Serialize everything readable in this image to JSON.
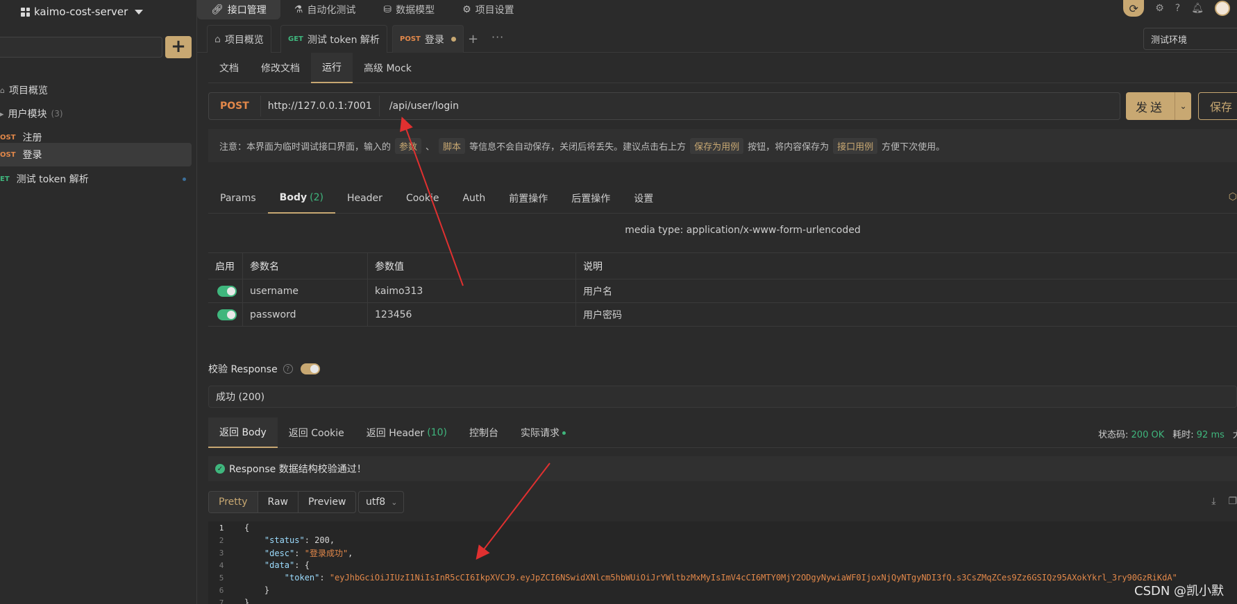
{
  "sidebar": {
    "project_name": "kaimo-cost-server",
    "items": [
      {
        "label": "项目概览",
        "method": ""
      },
      {
        "label": "用户模块",
        "method": "",
        "count": "(3)"
      },
      {
        "label": "注册",
        "method": "OST"
      },
      {
        "label": "登录",
        "method": "OST"
      },
      {
        "label": "测试 token 解析",
        "method": "ET"
      }
    ]
  },
  "topnav": {
    "items": [
      "接口管理",
      "自动化测试",
      "数据模型",
      "项目设置"
    ]
  },
  "tabs": [
    {
      "method": "",
      "label": "项目概览"
    },
    {
      "method": "GET",
      "label": "测试 token 解析"
    },
    {
      "method": "POST",
      "label": "登录"
    }
  ],
  "env": "测试环境",
  "subtabs": [
    "文档",
    "修改文档",
    "运行",
    "高级 Mock"
  ],
  "request": {
    "method": "POST",
    "base_url": "http://127.0.0.1:7001",
    "path": "/api/user/login",
    "send_label": "发送",
    "save_label": "保存"
  },
  "notice": {
    "prefix": "注意：本界面为临时调试接口界面，输入的",
    "hl1": "参数",
    "sep": "、",
    "hl2": "脚本",
    "mid": "等信息不会自动保存，关闭后将丢失。建议点击右上方",
    "hl3": "保存为用例",
    "mid2": "按钮，将内容保存为",
    "hl4": "接口用例",
    "suffix": "方便下次使用。"
  },
  "reqtabs": [
    {
      "label": "Params",
      "badge": ""
    },
    {
      "label": "Body",
      "badge": "(2)"
    },
    {
      "label": "Header",
      "badge": ""
    },
    {
      "label": "Cookie",
      "badge": ""
    },
    {
      "label": "Auth",
      "badge": ""
    },
    {
      "label": "前置操作",
      "badge": ""
    },
    {
      "label": "后置操作",
      "badge": ""
    },
    {
      "label": "设置",
      "badge": ""
    }
  ],
  "media_type": "media type: application/x-www-form-urlencoded",
  "params_table": {
    "headers": [
      "启用",
      "参数名",
      "参数值",
      "说明"
    ],
    "rows": [
      {
        "name": "username",
        "value": "kaimo313",
        "desc": "用户名"
      },
      {
        "name": "password",
        "value": "123456",
        "desc": "用户密码"
      }
    ]
  },
  "validate_label": "校验 Response",
  "response_select": "成功 (200)",
  "resptabs": [
    {
      "label": "返回 Body",
      "badge": ""
    },
    {
      "label": "返回 Cookie",
      "badge": ""
    },
    {
      "label": "返回 Header",
      "badge": "(10)"
    },
    {
      "label": "控制台",
      "badge": ""
    },
    {
      "label": "实际请求",
      "badge": ""
    }
  ],
  "status": {
    "code_label": "状态码:",
    "code": "200 OK",
    "time_label": "耗时:",
    "time": "92 ms",
    "size_label": "大"
  },
  "check_message": "Response 数据结构校验通过！",
  "view_modes": [
    "Pretty",
    "Raw",
    "Preview"
  ],
  "encoding": "utf8",
  "code_lines": [
    {
      "n": "1",
      "text": "{"
    },
    {
      "n": "2",
      "key": "\"status\"",
      "val": "200",
      "tail": ","
    },
    {
      "n": "3",
      "key": "\"desc\"",
      "val": "\"登录成功\"",
      "tail": ","
    },
    {
      "n": "4",
      "key": "\"data\"",
      "val": "{",
      "tail": ""
    },
    {
      "n": "5",
      "key": "\"token\"",
      "val": "\"eyJhbGciOiJIUzI1NiIsInR5cCI6IkpXVCJ9.eyJpZCI6NSwidXNlcm5hbWUiOiJrYWltbzMxMyIsImV4cCI6MTY0MjY2ODgyNywiaWF0IjoxNjQyNTgyNDI3fQ.s3CsZMqZCes9Zz6GSIQz95AXokYkrl_3ry90GzRiKdA\"",
      "tail": ""
    },
    {
      "n": "6",
      "text": "}"
    },
    {
      "n": "7",
      "text": "}"
    }
  ],
  "watermark": "CSDN @凯小默",
  "colors": {
    "accent": "#c8a872",
    "post": "#e2884a",
    "get": "#3fb67d",
    "arrow": "#e03030"
  }
}
